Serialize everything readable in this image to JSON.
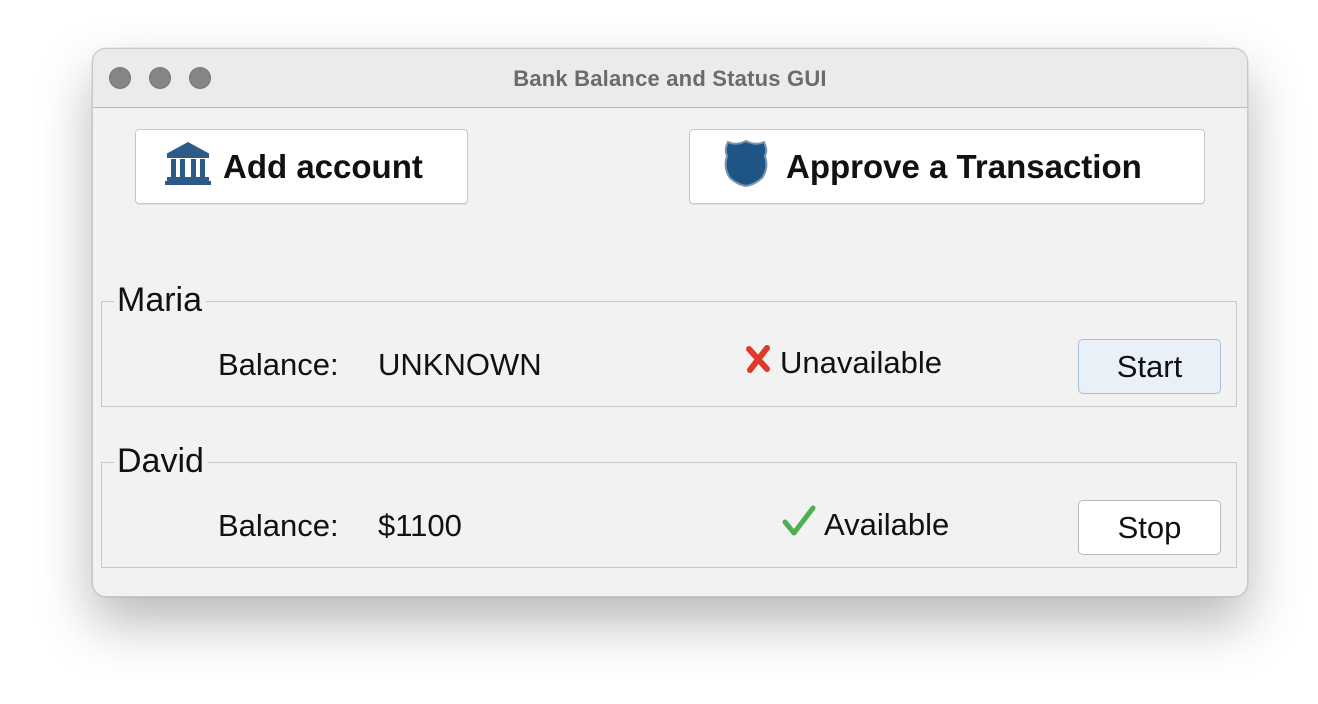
{
  "window": {
    "title": "Bank Balance and Status GUI"
  },
  "toolbar": {
    "add_account_label": "Add account",
    "add_account_icon": "bank-icon",
    "approve_label": "Approve a Transaction",
    "approve_icon": "shield-icon"
  },
  "accounts": [
    {
      "name": "Maria",
      "balance_label": "Balance:",
      "balance_value": "UNKNOWN",
      "status_icon": "x-mark-icon",
      "status_text": "Unavailable",
      "status_color": "#e0392b",
      "action_label": "Start"
    },
    {
      "name": "David",
      "balance_label": "Balance:",
      "balance_value": "$1100",
      "status_icon": "check-mark-icon",
      "status_text": "Available",
      "status_color": "#4caf50",
      "action_label": "Stop"
    }
  ],
  "colors": {
    "icon_blue": "#2c5b8a",
    "window_bg": "#f2f2f2"
  }
}
